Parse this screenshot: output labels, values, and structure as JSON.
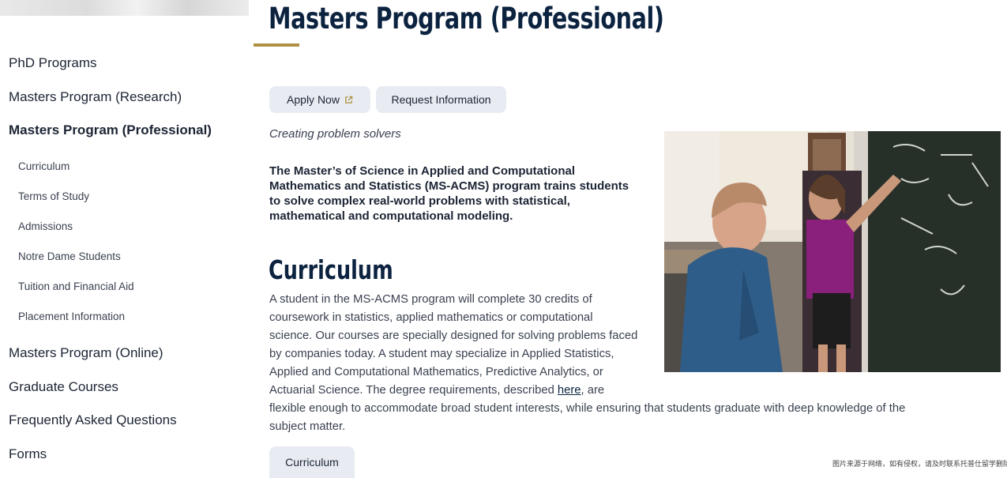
{
  "sidebar": {
    "items": [
      {
        "label": "PhD Programs"
      },
      {
        "label": "Masters Program (Research)"
      },
      {
        "label": "Masters Program (Professional)"
      },
      {
        "label": "Curriculum"
      },
      {
        "label": "Terms of Study"
      },
      {
        "label": "Admissions"
      },
      {
        "label": "Notre Dame Students"
      },
      {
        "label": "Tuition and Financial Aid"
      },
      {
        "label": "Placement Information"
      },
      {
        "label": "Masters Program (Online)"
      },
      {
        "label": "Graduate Courses"
      },
      {
        "label": "Frequently Asked Questions"
      },
      {
        "label": "Forms"
      }
    ]
  },
  "main": {
    "title": "Masters Program (Professional)",
    "buttons": {
      "apply": "Apply Now",
      "apply_icon": "external-link-icon",
      "request": "Request Information"
    },
    "tagline": "Creating problem solvers",
    "intro_lines": [
      "The Master’s of Science in Applied and Computational",
      "Mathematics and Statistics (MS-ACMS) program trains students",
      "to solve complex real-world problems with statistical,",
      "mathematical and computational modeling."
    ],
    "curriculum_heading": "Curriculum",
    "body_lines": [
      "A student in the MS-ACMS program will complete 30 credits of",
      "coursework in statistics, applied mathematics or computational",
      "science. Our courses are specially designed for solving problems faced",
      "by companies today. A student may specialize in Applied Statistics,",
      "Applied and Computational Mathematics, Predictive Analytics, or",
      "flexible enough to accommodate broad student interests, while ensuring that students graduate with deep knowledge of the",
      "subject matter."
    ],
    "body_line6_before": "Actuarial Science. The degree requirements, described ",
    "body_line6_link": "here",
    "body_line6_after": ", are",
    "curriculum_button": "Curriculum"
  },
  "watermark": "图片来源于网络，如有侵权，请及时联系托普仕留学删除",
  "colors": {
    "navy": "#0c2340",
    "gold": "#ae9142",
    "button_bg": "#e8ecf2"
  }
}
